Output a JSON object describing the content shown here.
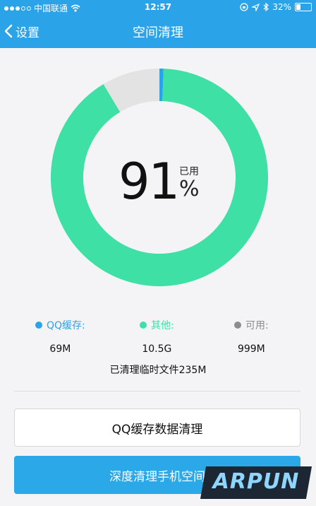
{
  "status_bar": {
    "carrier": "中国联通",
    "time": "12:57",
    "battery": "32%",
    "battery_level": 0.32
  },
  "nav": {
    "back_label": "设置",
    "title": "空间清理"
  },
  "usage": {
    "percent": "91",
    "used_label": "已用",
    "percent_sign": "%"
  },
  "chart_data": {
    "type": "pie",
    "categories": [
      "QQ缓存",
      "其他",
      "可用"
    ],
    "values": [
      0.069,
      10.5,
      0.999
    ],
    "value_labels": [
      "69M",
      "10.5G",
      "999M"
    ],
    "colors": [
      "#2aa3e8",
      "#3ee0a6",
      "#e3e3e3"
    ]
  },
  "legend": [
    {
      "label": "QQ缓存:",
      "value": "69M",
      "color": "#2aa3e8"
    },
    {
      "label": "其他:",
      "value": "10.5G",
      "color": "#3ee0a6"
    },
    {
      "label": "可用:",
      "value": "999M",
      "color": "#8c8c8c"
    }
  ],
  "cleaned_text": "已清理临时文件235M",
  "buttons": {
    "qq_cache_clean": "QQ缓存数据清理",
    "deep_clean": "深度清理手机空间"
  },
  "watermark": "ARPUN"
}
